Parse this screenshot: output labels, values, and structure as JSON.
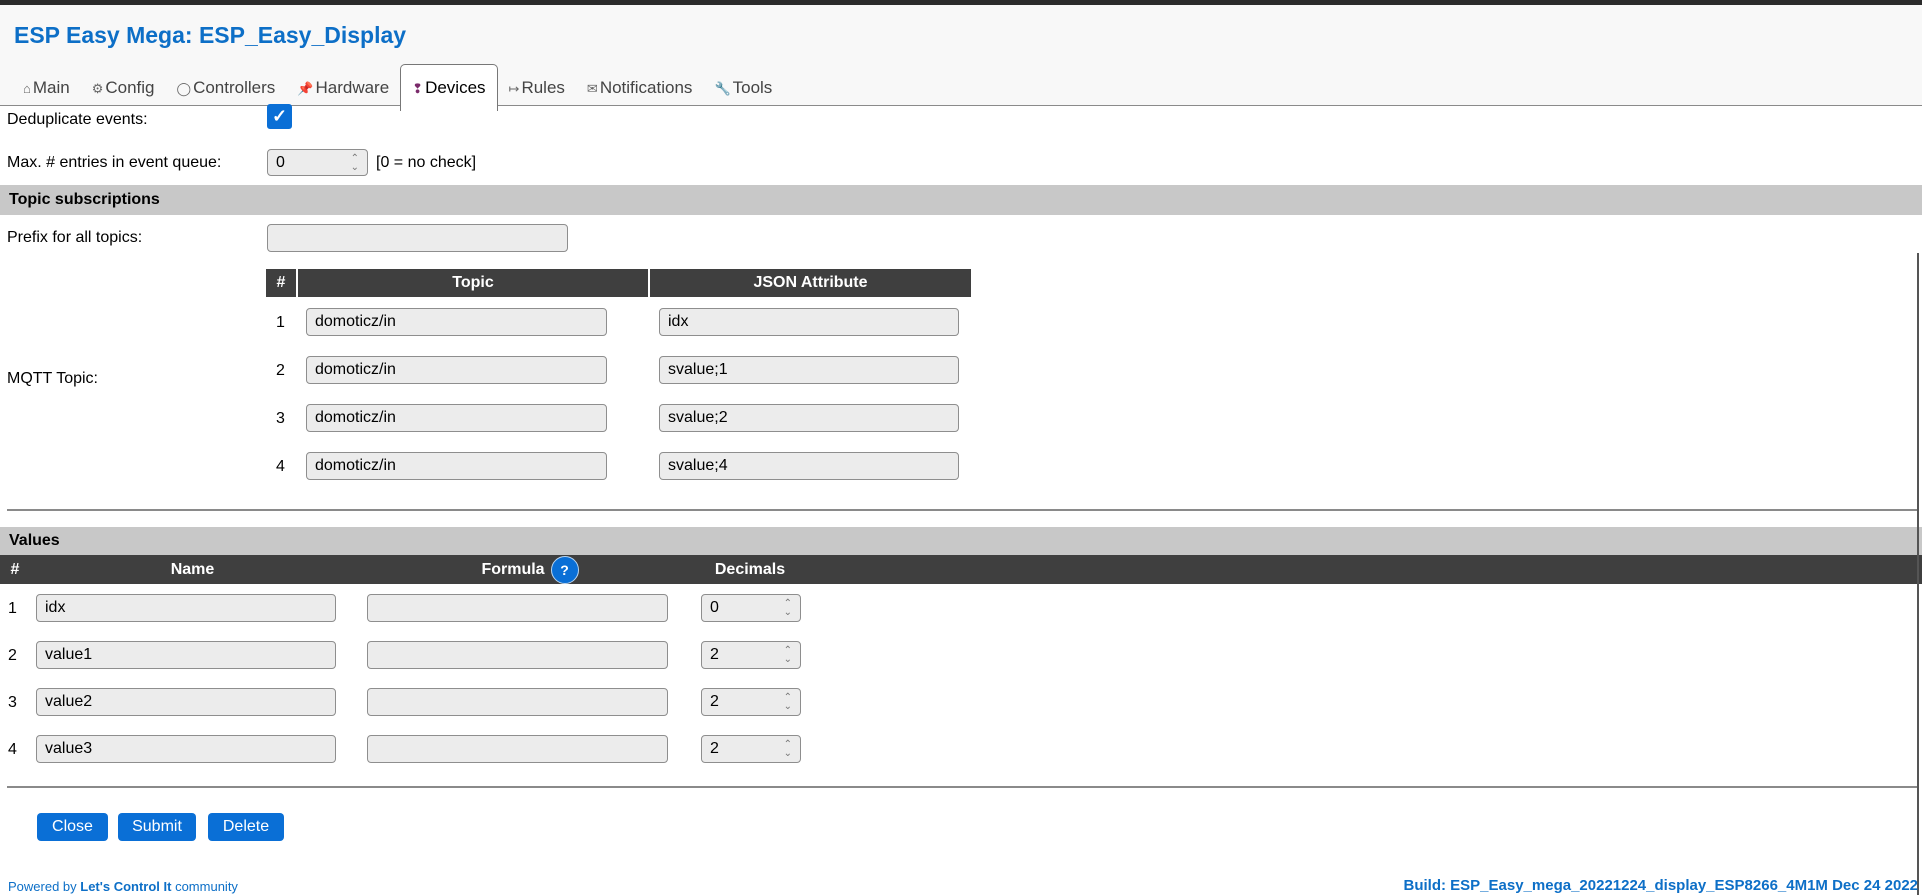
{
  "header": {
    "title": "ESP Easy Mega: ESP_Easy_Display",
    "tabs": [
      {
        "icon": "⌂",
        "label": "Main"
      },
      {
        "icon": "⚙",
        "label": "Config"
      },
      {
        "icon": "◯",
        "label": "Controllers"
      },
      {
        "icon": "📌",
        "label": "Hardware"
      },
      {
        "icon": "❢",
        "label": "Devices"
      },
      {
        "icon": "↦",
        "label": "Rules"
      },
      {
        "icon": "✉",
        "label": "Notifications"
      },
      {
        "icon": "🔧",
        "label": "Tools"
      }
    ],
    "active_tab": "Devices"
  },
  "settings": {
    "dedup_label": "Deduplicate events:",
    "dedup_checked": true,
    "queue_label": "Max. # entries in event queue:",
    "queue_value": "0",
    "queue_hint": "[0 = no check]"
  },
  "topics": {
    "section_title": "Topic subscriptions",
    "prefix_label": "Prefix for all topics:",
    "prefix_value": "",
    "mqtt_label": "MQTT Topic:",
    "columns": {
      "num": "#",
      "topic": "Topic",
      "json": "JSON Attribute"
    },
    "rows": [
      {
        "num": "1",
        "topic": "domoticz/in",
        "json": "idx"
      },
      {
        "num": "2",
        "topic": "domoticz/in",
        "json": "svalue;1"
      },
      {
        "num": "3",
        "topic": "domoticz/in",
        "json": "svalue;2"
      },
      {
        "num": "4",
        "topic": "domoticz/in",
        "json": "svalue;4"
      }
    ]
  },
  "values": {
    "section_title": "Values",
    "columns": {
      "num": "#",
      "name": "Name",
      "formula": "Formula",
      "decimals": "Decimals"
    },
    "help_icon": "?",
    "rows": [
      {
        "num": "1",
        "name": "idx",
        "formula": "",
        "decimals": "0"
      },
      {
        "num": "2",
        "name": "value1",
        "formula": "",
        "decimals": "2"
      },
      {
        "num": "3",
        "name": "value2",
        "formula": "",
        "decimals": "2"
      },
      {
        "num": "4",
        "name": "value3",
        "formula": "",
        "decimals": "2"
      }
    ]
  },
  "buttons": {
    "close": "Close",
    "submit": "Submit",
    "delete": "Delete"
  },
  "footer": {
    "powered_prefix": "Powered by ",
    "powered_link": "Let's Control It",
    "powered_suffix": " community",
    "build": "Build: ESP_Easy_mega_20221224_display_ESP8266_4M1M Dec 24 2022"
  },
  "colors": {
    "accent": "#0a6fd6",
    "title": "#0d6fc7",
    "section": "#c8c8c8",
    "table_header": "#3f3f3f"
  }
}
